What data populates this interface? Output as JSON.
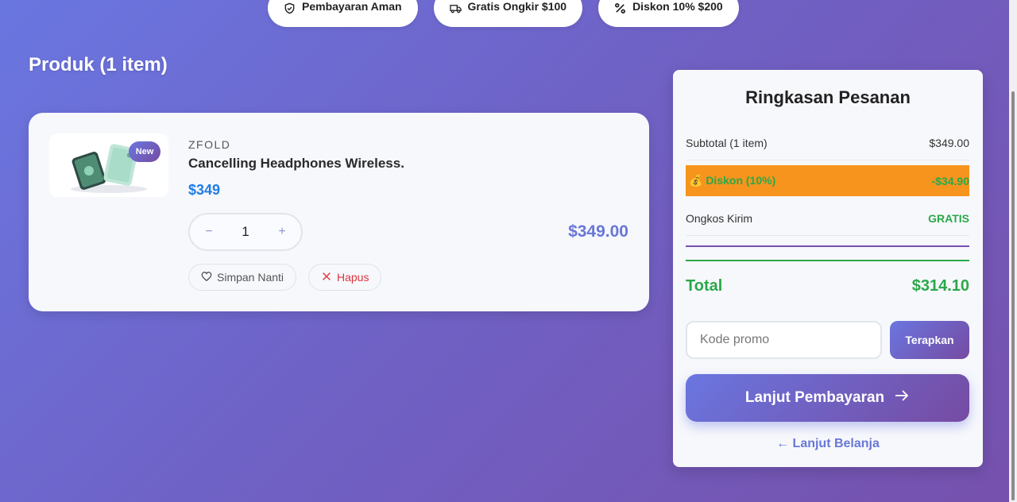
{
  "badges": [
    {
      "icon": "shield-icon",
      "label": "Pembayaran Aman"
    },
    {
      "icon": "truck-icon",
      "label": "Gratis Ongkir $100"
    },
    {
      "icon": "percent-icon",
      "label": "Diskon 10% $200"
    }
  ],
  "products": {
    "title": "Produk (1 item)",
    "items": [
      {
        "badge": "New",
        "brand": "ZFOLD",
        "name": "Cancelling Headphones Wireless.",
        "price": "$349",
        "quantity": "1",
        "line_total": "$349.00",
        "save_label": "Simpan Nanti",
        "remove_label": "Hapus"
      }
    ]
  },
  "summary": {
    "title": "Ringkasan Pesanan",
    "subtotal_label": "Subtotal (1 item)",
    "subtotal_value": "$349.00",
    "discount_label": "💰 Diskon (10%)",
    "discount_value": "-$34.90",
    "shipping_label": "Ongkos Kirim",
    "shipping_value": "GRATIS",
    "total_label": "Total",
    "total_value": "$314.10",
    "promo_placeholder": "Kode promo",
    "apply_label": "Terapkan",
    "checkout_label": "Lanjut Pembayaran",
    "continue_label": "← Lanjut Belanja"
  },
  "colors": {
    "accent": "#6a76e0",
    "accent_dark": "#764ba2",
    "success": "#2ba84a",
    "discount_bg": "#f7941d",
    "price_blue": "#1f7de6",
    "danger": "#d9363e"
  }
}
